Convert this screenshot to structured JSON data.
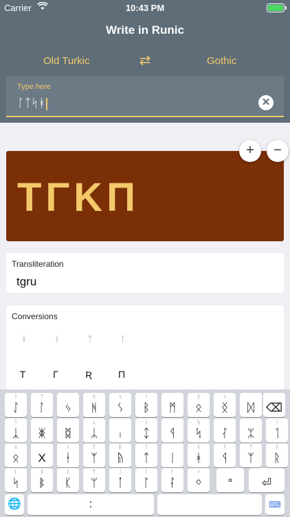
{
  "status_bar": {
    "carrier": "Carrier",
    "time": "10:43 PM"
  },
  "header": {
    "title": "Write in Runic",
    "source_lang": "Old Turkic",
    "target_lang": "Gothic"
  },
  "input": {
    "label": "Type here",
    "value": "ᛚᛏᛋᚼ"
  },
  "zoom": {
    "plus": "+",
    "minus": "−"
  },
  "display": {
    "runic_text": "TΓKΠ"
  },
  "transliteration": {
    "label": "Transliteration",
    "value": "tgru"
  },
  "conversions": {
    "label": "Conversions",
    "row1": [
      "ᚼ",
      "ᚾ",
      "ᛏ",
      "ᛚ"
    ],
    "row2": [
      "Τ",
      "Γ",
      "Ʀ",
      "Π"
    ]
  },
  "keyboard": {
    "rows": [
      [
        {
          "sup": "ᛏ",
          "main": "ᛇ"
        },
        {
          "sup": "ᛉ",
          "main": "ᛚ"
        },
        {
          "sup": "",
          "main": "ᛃ"
        },
        {
          "sup": "ᚺ",
          "main": "ᚻ"
        },
        {
          "sup": "ᛋ",
          "main": "ᛊ"
        },
        {
          "sup": "ᛊ",
          "main": "ᛒ"
        },
        {
          "sup": "",
          "main": "ᛗ"
        },
        {
          "sup": "ᛝ",
          "main": "ᛟ"
        },
        {
          "sup": "ᛜ",
          "main": "ᛝ"
        },
        {
          "sup": "",
          "main": "ᛞ"
        }
      ],
      [
        {
          "sup": "ᛏ",
          "main": "ᛣ"
        },
        {
          "sup": "",
          "main": "ᛤ"
        },
        {
          "sup": "",
          "main": "ᛥ"
        },
        {
          "sup": "ᛦ",
          "main": "ᛦ"
        },
        {
          "sup": "",
          "main": "ᛧ"
        },
        {
          "sup": "ᚾ",
          "main": "ᛨ"
        },
        {
          "sup": "",
          "main": "ᛩ"
        },
        {
          "sup": "ᛪ",
          "main": "ᛪ"
        },
        {
          "sup": "",
          "main": "ᛮ"
        },
        {
          "sup": "",
          "main": "ᛯ"
        },
        {
          "sup": "ᛐ",
          "main": "ᛐ"
        }
      ],
      [
        {
          "sup": "ᛟ",
          "main": "ᛟ"
        },
        {
          "sup": "",
          "main": "Χ"
        },
        {
          "sup": "ᛂ",
          "main": "ᛂ"
        },
        {
          "sup": "ᛉ",
          "main": "ᛉ"
        },
        {
          "sup": "ᚥ",
          "main": "ᚥ"
        },
        {
          "sup": "ᛏ",
          "main": "ᛏ"
        },
        {
          "sup": "",
          "main": "ᛁ"
        },
        {
          "sup": "ᚼ",
          "main": "ᚼ"
        },
        {
          "sup": "ᛩ",
          "main": "ᛩ"
        },
        {
          "sup": "ᛉ",
          "main": "ᛉ"
        },
        {
          "sup": "ᚱ",
          "main": "ᚱ"
        }
      ],
      [
        {
          "sup": "ᚦ",
          "main": "ᛋ"
        },
        {
          "sup": "ᛔ",
          "main": "ᛔ"
        },
        {
          "sup": "ᛕ",
          "main": "ᛕ"
        },
        {
          "sup": "ᛘ",
          "main": "ᛘ"
        },
        {
          "sup": "ᛙ",
          "main": "ᛙ"
        },
        {
          "sup": "ᛚ",
          "main": "ᛚ"
        },
        {
          "sup": "ᛛ",
          "main": "ᛛ"
        },
        {
          "sup": "ᛜ",
          "main": "ᛜ"
        },
        {
          "sup": "",
          "main": "°"
        },
        {
          "sup": "",
          "main": "⏎"
        }
      ]
    ],
    "space_label": ":",
    "backspace_icon": "backspace-icon",
    "globe_icon": "globe-icon",
    "keyboard_icon": "keyboard-icon"
  }
}
